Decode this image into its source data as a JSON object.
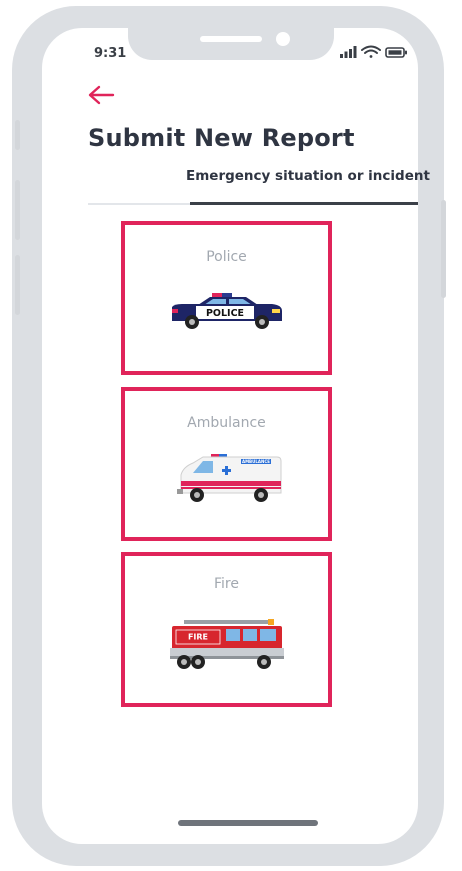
{
  "status_bar": {
    "time": "9:31"
  },
  "header": {
    "title": "Submit New Report"
  },
  "tabs": [
    {
      "label": "Emergency situation or incident",
      "active": true
    }
  ],
  "report_types": [
    {
      "label": "Police",
      "icon": "police-car-icon",
      "vehicle_text": "POLICE"
    },
    {
      "label": "Ambulance",
      "icon": "ambulance-icon",
      "vehicle_text": "AMBULANCE"
    },
    {
      "label": "Fire",
      "icon": "fire-truck-icon",
      "vehicle_text": "FIRE"
    }
  ],
  "colors": {
    "accent": "#e0245a",
    "title": "#2f3542",
    "card_label": "#a2a8b0",
    "frame": "#dcdfe3"
  }
}
